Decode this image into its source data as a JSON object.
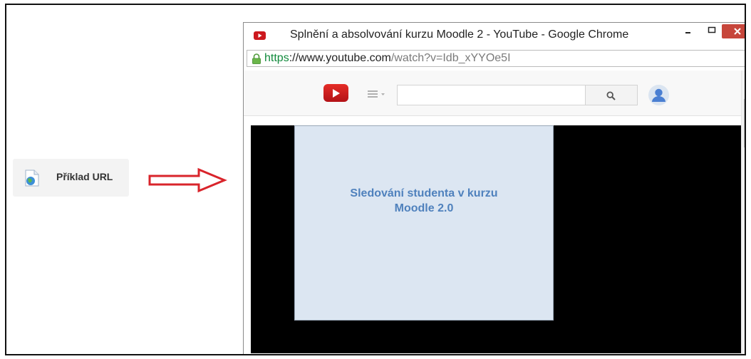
{
  "left_item": {
    "label": "Příklad URL",
    "icon": "url-resource-icon"
  },
  "arrow": {
    "color": "#d9242b"
  },
  "window": {
    "title": "Splnění a absolvování kurzu Moodle 2 - YouTube - Google Chrome",
    "favicon": "youtube-favicon",
    "controls": {
      "minimize": "–",
      "maximize": "□",
      "close": "✕"
    },
    "address": {
      "scheme": "https",
      "host": "://www.youtube.com",
      "path": "/watch?v=Idb_xYYOe5I"
    }
  },
  "youtube": {
    "search_placeholder": "",
    "guide_icon": "menu-icon",
    "search_icon": "search-icon",
    "avatar_icon": "user-avatar-icon"
  },
  "video": {
    "slide_text_line1": "Sledování studenta v kurzu",
    "slide_text_line2": "Moodle 2.0"
  },
  "colors": {
    "accent_red": "#e52d27",
    "close_button": "#c7463b",
    "slide_bg": "#dce6f2",
    "slide_text": "#4f81bd",
    "https_green": "#118a3c"
  }
}
